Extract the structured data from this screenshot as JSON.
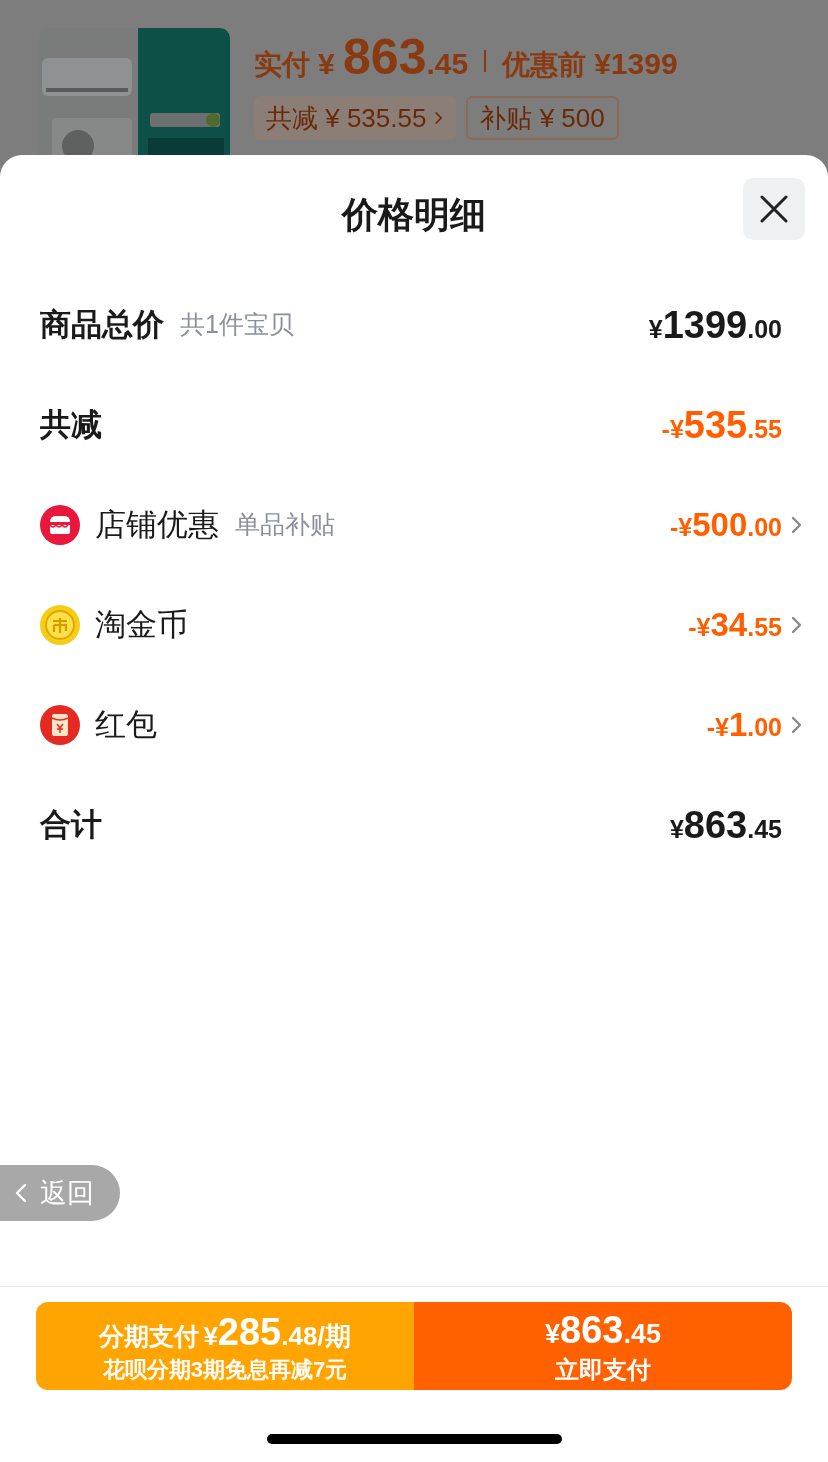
{
  "product": {
    "paid_label": "实付",
    "paid_price": "¥ 863.45",
    "before_label": "优惠前",
    "before_price": "¥1399",
    "chips": [
      {
        "text": "共减 ¥ 535.55",
        "chevron": true
      },
      {
        "text": "补贴 ¥ 500",
        "chevron": false
      }
    ]
  },
  "sheet": {
    "title": "价格明细",
    "rows": [
      {
        "kind": "total",
        "label": "商品总价",
        "note": "共1件宝贝",
        "amount": "¥1399.00",
        "chevron": false
      },
      {
        "kind": "reduction",
        "label": "共减",
        "amount": "-¥535.55",
        "chevron": false
      },
      {
        "kind": "shop",
        "label": "店铺优惠",
        "note": "单品补贴",
        "amount": "-¥500.00",
        "chevron": true
      },
      {
        "kind": "coin",
        "label": "淘金币",
        "amount": "-¥34.55",
        "chevron": true
      },
      {
        "kind": "packet",
        "label": "红包",
        "amount": "-¥1.00",
        "chevron": true
      },
      {
        "kind": "total",
        "label": "合计",
        "amount": "¥863.45",
        "chevron": false
      }
    ]
  },
  "back_button": "返回",
  "installment": {
    "label": "分期支付",
    "price": "¥285.48/期",
    "note": "花呗分期3期免息再减7元"
  },
  "pay_now": {
    "price": "¥863.45",
    "label": "立即支付"
  }
}
